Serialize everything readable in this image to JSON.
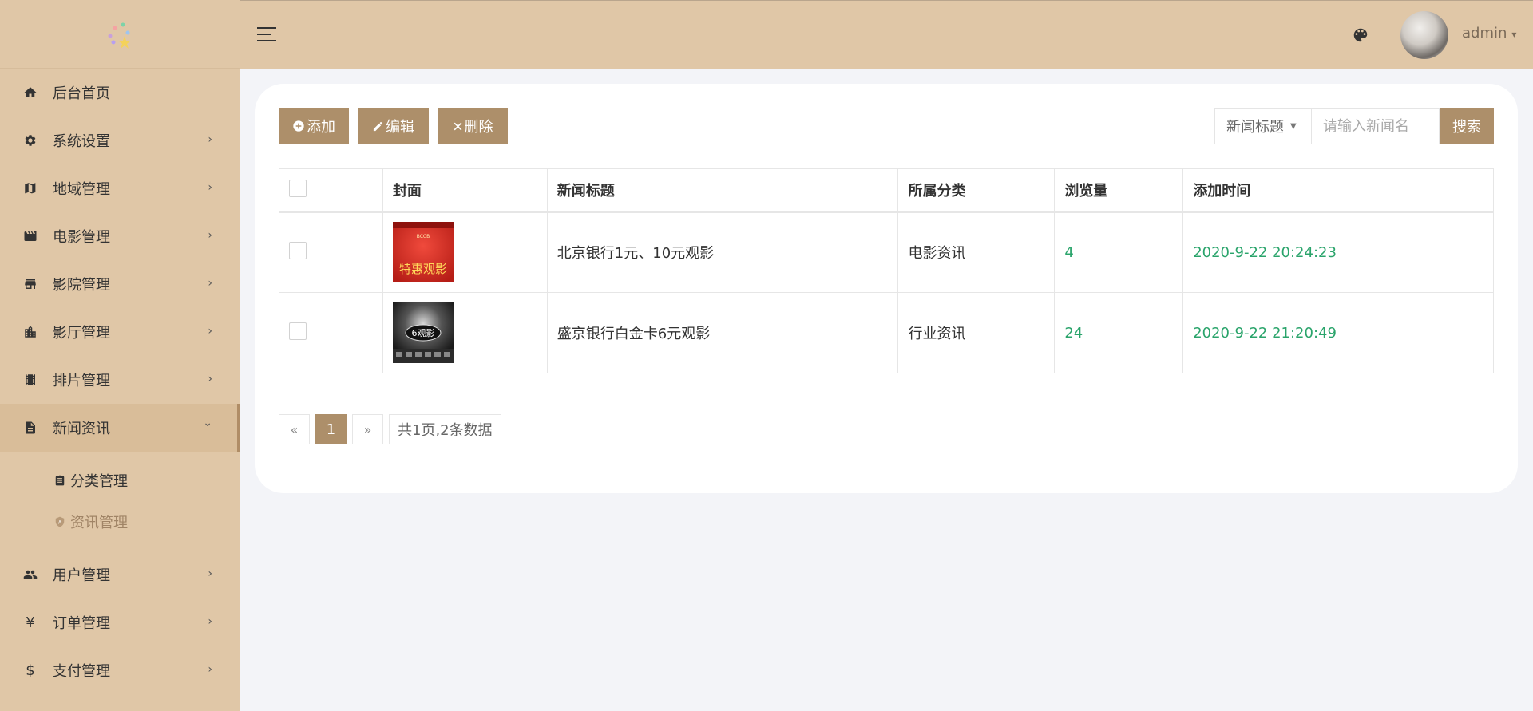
{
  "colors": {
    "accent": "#ad8f6a",
    "sidebar": "#e0c7a7",
    "green": "#2aa46b"
  },
  "sidebar": {
    "items": [
      {
        "label": "后台首页",
        "icon": "home-icon",
        "has_arrow": false
      },
      {
        "label": "系统设置",
        "icon": "gear-icon",
        "has_arrow": true
      },
      {
        "label": "地域管理",
        "icon": "map-icon",
        "has_arrow": true
      },
      {
        "label": "电影管理",
        "icon": "clapperboard-icon",
        "has_arrow": true
      },
      {
        "label": "影院管理",
        "icon": "store-icon",
        "has_arrow": true
      },
      {
        "label": "影厅管理",
        "icon": "building-icon",
        "has_arrow": true
      },
      {
        "label": "排片管理",
        "icon": "film-icon",
        "has_arrow": true
      },
      {
        "label": "新闻资讯",
        "icon": "article-icon",
        "has_arrow": true,
        "expanded": true
      }
    ],
    "submenu": [
      {
        "label": "分类管理",
        "icon": "clipboard-icon"
      },
      {
        "label": "资讯管理",
        "icon": "shield-icon",
        "current": true
      }
    ],
    "items_after": [
      {
        "label": "用户管理",
        "icon": "users-icon"
      },
      {
        "label": "订单管理",
        "icon": "yen-icon"
      },
      {
        "label": "支付管理",
        "icon": "dollar-icon"
      }
    ],
    "arrow": "›",
    "arrow_down": "⌄"
  },
  "header": {
    "user": "admin"
  },
  "toolbar": {
    "add_label": "添加",
    "edit_label": "编辑",
    "delete_label": "删除",
    "search_field": "新闻标题",
    "search_placeholder": "请输入新闻名",
    "search_button": "搜索"
  },
  "table": {
    "headers": [
      "封面",
      "新闻标题",
      "所属分类",
      "浏览量",
      "添加时间"
    ],
    "rows": [
      {
        "cover_text": "特惠观影",
        "title": "北京银行1元、10元观影",
        "category": "电影资讯",
        "views": "4",
        "time": "2020-9-22 20:24:23"
      },
      {
        "cover_text": "6观影",
        "title": "盛京银行白金卡6元观影",
        "category": "行业资讯",
        "views": "24",
        "time": "2020-9-22 21:20:49"
      }
    ]
  },
  "pager": {
    "prev": "«",
    "current": "1",
    "next": "»",
    "info": "共1页,2条数据"
  }
}
